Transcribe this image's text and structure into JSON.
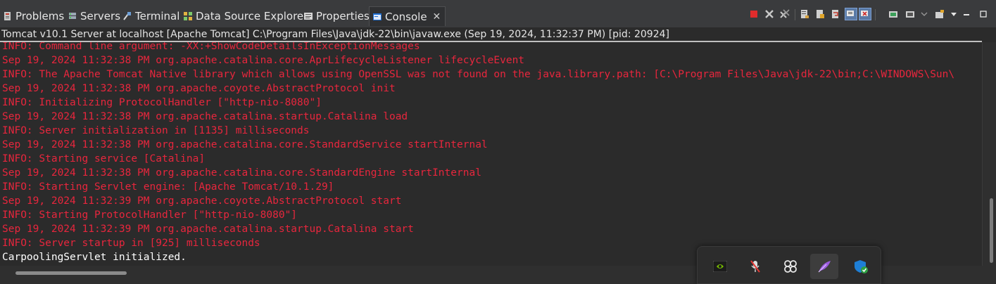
{
  "tabs": [
    {
      "label": "Problems",
      "icon": "problems-icon"
    },
    {
      "label": "Servers",
      "icon": "servers-icon"
    },
    {
      "label": "Terminal",
      "icon": "terminal-icon"
    },
    {
      "label": "Data Source Explorer",
      "icon": "data-source-explorer-icon"
    },
    {
      "label": "Properties",
      "icon": "properties-icon"
    },
    {
      "label": "Console",
      "icon": "console-icon",
      "active": true
    }
  ],
  "console_title": "Tomcat v10.1 Server at localhost [Apache Tomcat] C:\\Program Files\\Java\\jdk-22\\bin\\javaw.exe  (Sep 19, 2024, 11:32:37 PM) [pid: 20924]",
  "console_lines": [
    {
      "text": "INFO: Command line argument: -XX:+ShowCodeDetailsInExceptionMessages",
      "stream": "err"
    },
    {
      "text": "Sep 19, 2024 11:32:38 PM org.apache.catalina.core.AprLifecycleListener lifecycleEvent",
      "stream": "err"
    },
    {
      "text": "INFO: The Apache Tomcat Native library which allows using OpenSSL was not found on the java.library.path: [C:\\Program Files\\Java\\jdk-22\\bin;C:\\WINDOWS\\Sun\\",
      "stream": "err"
    },
    {
      "text": "Sep 19, 2024 11:32:38 PM org.apache.coyote.AbstractProtocol init",
      "stream": "err"
    },
    {
      "text": "INFO: Initializing ProtocolHandler [\"http-nio-8080\"]",
      "stream": "err"
    },
    {
      "text": "Sep 19, 2024 11:32:38 PM org.apache.catalina.startup.Catalina load",
      "stream": "err"
    },
    {
      "text": "INFO: Server initialization in [1135] milliseconds",
      "stream": "err"
    },
    {
      "text": "Sep 19, 2024 11:32:38 PM org.apache.catalina.core.StandardService startInternal",
      "stream": "err"
    },
    {
      "text": "INFO: Starting service [Catalina]",
      "stream": "err"
    },
    {
      "text": "Sep 19, 2024 11:32:38 PM org.apache.catalina.core.StandardEngine startInternal",
      "stream": "err"
    },
    {
      "text": "INFO: Starting Servlet engine: [Apache Tomcat/10.1.29]",
      "stream": "err"
    },
    {
      "text": "Sep 19, 2024 11:32:39 PM org.apache.coyote.AbstractProtocol start",
      "stream": "err"
    },
    {
      "text": "INFO: Starting ProtocolHandler [\"http-nio-8080\"]",
      "stream": "err"
    },
    {
      "text": "Sep 19, 2024 11:32:39 PM org.apache.catalina.startup.Catalina start",
      "stream": "err"
    },
    {
      "text": "INFO: Server startup in [925] milliseconds",
      "stream": "err"
    },
    {
      "text": "CarpoolingServlet initialized.",
      "stream": "out"
    }
  ],
  "toolbar_icons": [
    "terminate-icon",
    "remove-launch-icon",
    "remove-all-terminated-icon",
    "clear-console-icon",
    "scroll-lock-icon",
    "word-wrap-icon",
    "show-console-on-stdout-icon",
    "show-console-on-stderr-icon",
    "pin-console-icon",
    "display-selected-console-icon",
    "open-console-icon",
    "view-menu-icon",
    "minimize-icon",
    "maximize-icon"
  ],
  "tray_icons": [
    "nvidia-icon",
    "microphone-muted-icon",
    "bluetooth-device-icon",
    "feather-app-icon",
    "windows-security-icon"
  ],
  "colors": {
    "stderr": "#e8263d",
    "stdout": "#ffffff",
    "background": "#2b2b2b"
  }
}
